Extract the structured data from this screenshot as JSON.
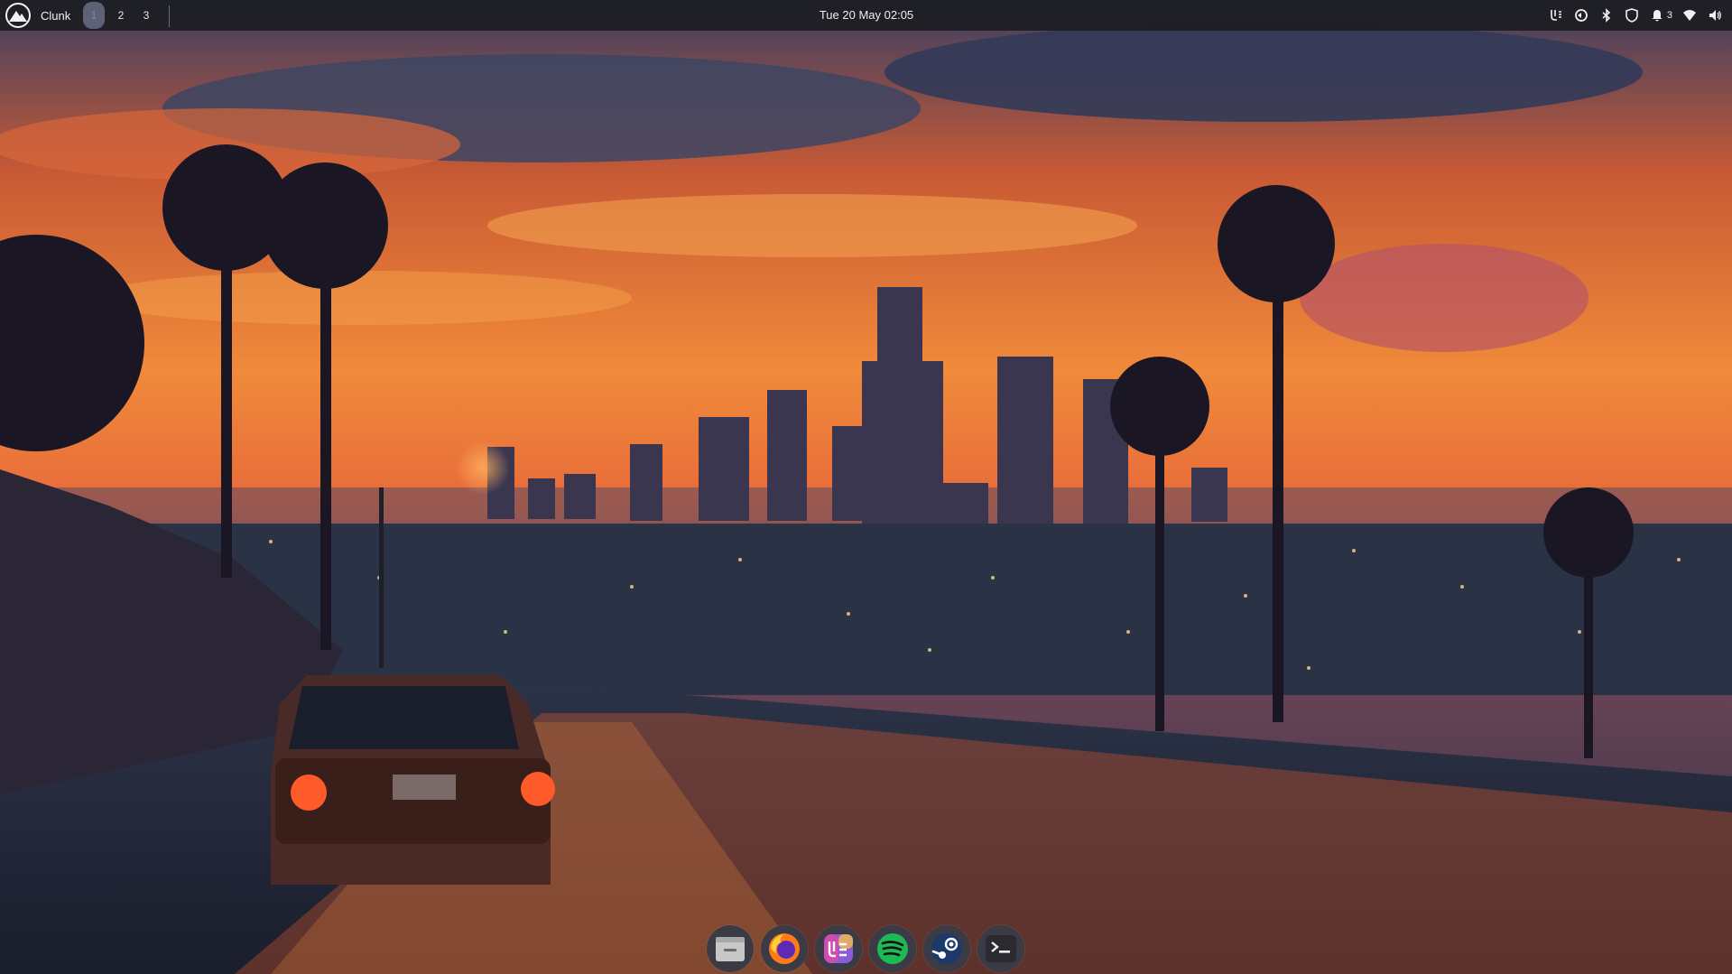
{
  "desktop": {
    "wallpaper": "sunset-city-highway-wallpaper"
  },
  "topbar": {
    "app_name": "Clunk",
    "launcher_icon": "mountain-logo-icon",
    "workspaces": [
      {
        "label": "1",
        "active": true
      },
      {
        "label": "2",
        "active": false
      },
      {
        "label": "3",
        "active": false
      }
    ],
    "clock": "Tue 20 May 02:05",
    "tray": {
      "icons": [
        "app-tray-icon",
        "sync-icon",
        "bluetooth-icon",
        "shield-icon",
        "notification-bell-icon",
        "wifi-icon",
        "volume-icon"
      ],
      "notification_count": "3"
    }
  },
  "dock": {
    "items": [
      {
        "name": "files",
        "icon": "files-icon"
      },
      {
        "name": "firefox",
        "icon": "firefox-icon"
      },
      {
        "name": "vscode-like-editor",
        "icon": "editor-icon"
      },
      {
        "name": "spotify",
        "icon": "spotify-icon"
      },
      {
        "name": "steam",
        "icon": "steam-icon"
      },
      {
        "name": "terminal",
        "icon": "terminal-icon"
      }
    ]
  },
  "colors": {
    "panel": "#1c1c22",
    "active_workspace": "#5e6278",
    "spotify_green": "#1db954",
    "firefox_orange": "#ff7a1a",
    "steam_blue": "#1b3a6b"
  }
}
